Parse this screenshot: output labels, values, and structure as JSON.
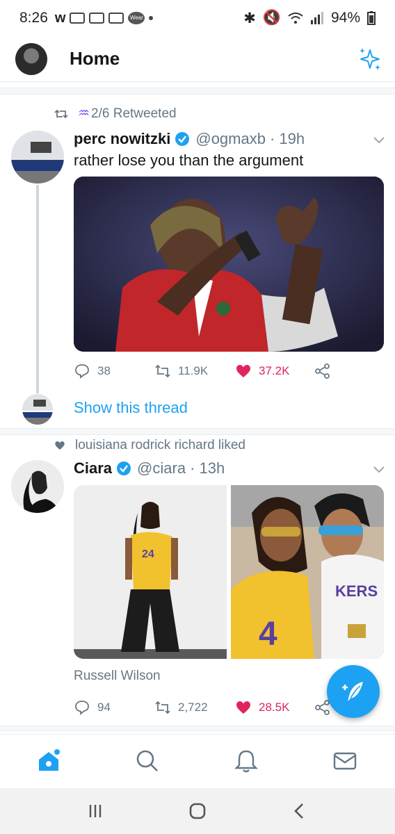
{
  "status_bar": {
    "time": "8:26",
    "battery": "94%",
    "wear_label": "Wear"
  },
  "app_bar": {
    "title": "Home"
  },
  "tweets": [
    {
      "social_context": "♒♒ 2/6 Retweeted",
      "social_context_display": "2/6 Retweeted",
      "name": "perc nowitzki",
      "handle": "@ogmaxb",
      "time": "· 19h",
      "text": "rather lose you than the argument",
      "replies": "38",
      "retweets": "11.9K",
      "likes": "37.2K",
      "show_thread": "Show this thread"
    },
    {
      "social_context": "louisiana rodrick richard liked",
      "name": "Ciara",
      "handle": "@ciara",
      "time": "· 13h",
      "media_caption": "Russell Wilson",
      "replies": "94",
      "retweets": "2,722",
      "likes": "28.5K"
    }
  ],
  "colors": {
    "accent": "#1da1f2",
    "like": "#e0245e",
    "muted": "#657786"
  },
  "icons": {
    "reply": "reply-icon",
    "retweet": "retweet-icon",
    "like": "heart-icon",
    "share": "share-icon",
    "compose": "compose-tweet-icon",
    "sparkle": "top-tweets-sparkle-icon"
  },
  "bottom_tabs": [
    "home",
    "search",
    "notifications",
    "messages"
  ]
}
